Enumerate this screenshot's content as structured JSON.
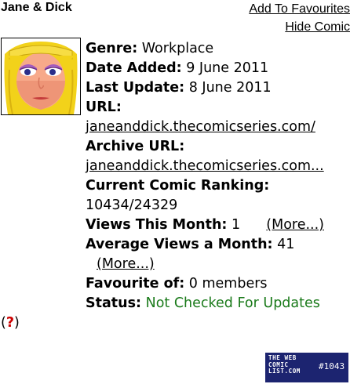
{
  "comic": {
    "title": "Jane & Dick"
  },
  "links": {
    "add_favourites": "Add To Favourites",
    "hide_comic": "Hide Comic"
  },
  "details": {
    "genre_label": "Genre:",
    "genre": "Workplace",
    "date_added_label": "Date Added:",
    "date_added": "9 June 2011",
    "last_update_label": "Last Update:",
    "last_update": "8 June 2011",
    "url_label": "URL:",
    "url": "janeanddick.thecomicseries.com/",
    "archive_url_label": "Archive URL:",
    "archive_url": "janeanddick.thecomicseries.com...",
    "ranking_label": "Current Comic Ranking:",
    "ranking": "10434/24329",
    "views_month_label": "Views This Month:",
    "views_month": "1",
    "views_month_more": "(More...)",
    "avg_views_label": "Average Views a Month:",
    "avg_views": "41",
    "avg_views_more": "(More...)",
    "favourite_label": "Favourite of:",
    "favourite": "0 members",
    "status_label": "Status:",
    "status": "Not Checked For Updates",
    "help_open": "(",
    "help_mark": "?",
    "help_close": ")"
  },
  "badge": {
    "logo_line1": "THE WEB",
    "logo_line2": "COMIC",
    "logo_line3": "LIST.COM",
    "rank": "#1043"
  },
  "colors": {
    "status_green": "#1a7a1a",
    "help_red": "#cc0000",
    "badge_bg": "#1c2470"
  }
}
